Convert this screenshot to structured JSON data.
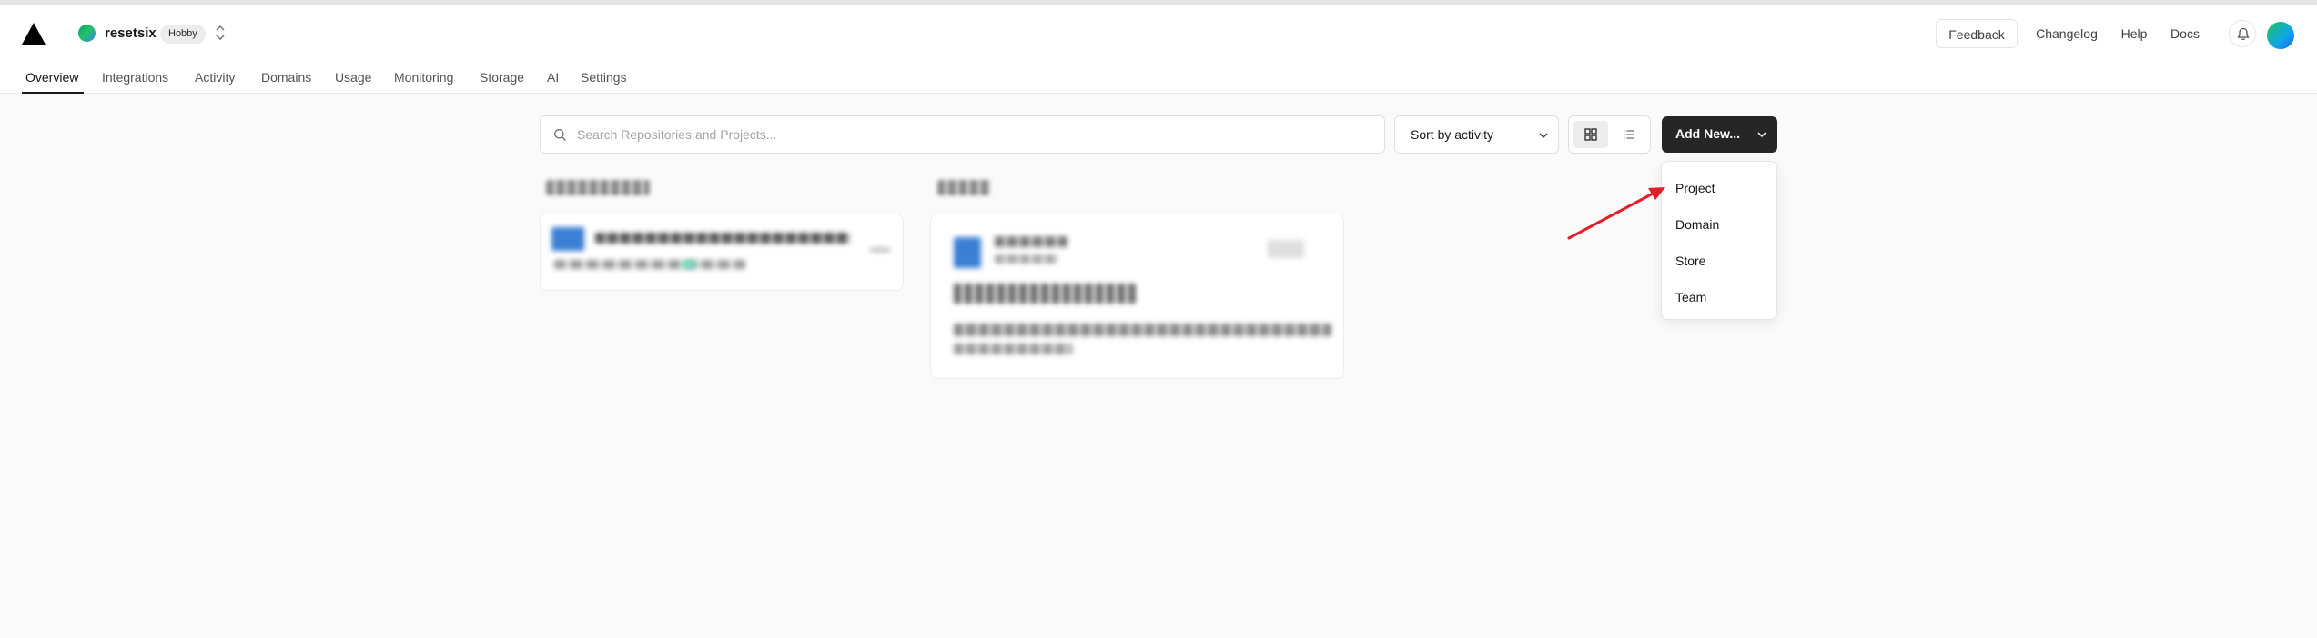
{
  "header": {
    "team_name": "resetsix",
    "plan_badge": "Hobby",
    "links": {
      "feedback": "Feedback",
      "changelog": "Changelog",
      "help": "Help",
      "docs": "Docs"
    }
  },
  "tabs": [
    "Overview",
    "Integrations",
    "Activity",
    "Domains",
    "Usage",
    "Monitoring",
    "Storage",
    "AI",
    "Settings"
  ],
  "active_tab": "Overview",
  "toolbar": {
    "search_placeholder": "Search Repositories and Projects...",
    "sort_label": "Sort by activity",
    "view_mode": "grid",
    "add_new_label": "Add New..."
  },
  "add_new_menu": {
    "items": [
      "Project",
      "Domain",
      "Store",
      "Team"
    ]
  },
  "colors": {
    "accent_dark": "#262626",
    "annotation_arrow": "#e11d2a"
  },
  "icons": [
    "logo-triangle-icon",
    "team-switcher-icon",
    "bell-icon",
    "search-icon",
    "chevron-down-icon",
    "grid-view-icon",
    "list-view-icon"
  ]
}
